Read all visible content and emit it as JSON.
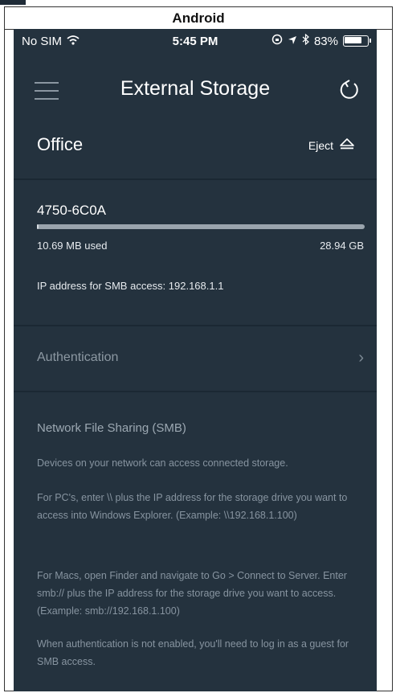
{
  "platform_label": "Android",
  "statusbar": {
    "carrier": "No SIM",
    "time": "5:45 PM",
    "battery_percent": "83%",
    "battery_level": 0.83
  },
  "navbar": {
    "title": "External Storage"
  },
  "storage": {
    "location": "Office",
    "eject_label": "Eject",
    "device_name": "4750-6C0A",
    "used": "10.69 MB used",
    "total": "28.94 GB",
    "used_fraction": 0.0004,
    "ip_text": "IP address for SMB access: 192.168.1.1"
  },
  "authentication": {
    "label": "Authentication"
  },
  "smb": {
    "title": "Network File Sharing (SMB)",
    "paragraphs": [
      "Devices on your network can access connected storage.",
      "For PC's, enter \\\\ plus the IP address for the storage drive you want to access into Windows Explorer. (Example: \\\\192.168.1.100)",
      "For Macs, open Finder and navigate to Go > Connect to Server. Enter smb:// plus the IP address for the storage drive you want to access. (Example: smb://192.168.1.100)",
      "When authentication is not enabled, you'll need to log in as a guest for SMB access."
    ]
  }
}
